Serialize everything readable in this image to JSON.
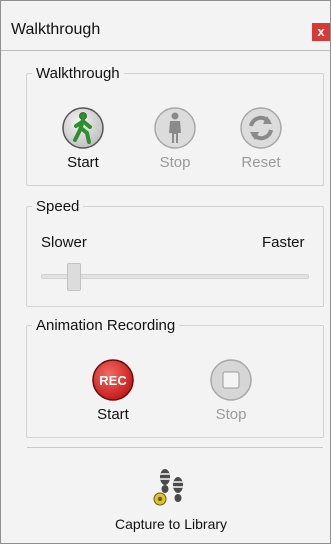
{
  "window": {
    "title": "Walkthrough",
    "close_glyph": "x"
  },
  "walkthrough_group": {
    "label": "Walkthrough",
    "buttons": [
      {
        "label": "Start",
        "icon": "walk-person-icon",
        "enabled": true,
        "accent": "#2d8f2d"
      },
      {
        "label": "Stop",
        "icon": "stand-person-icon",
        "enabled": false
      },
      {
        "label": "Reset",
        "icon": "reset-arrows-icon",
        "enabled": false
      }
    ]
  },
  "speed_group": {
    "label": "Speed",
    "min_label": "Slower",
    "max_label": "Faster",
    "value_fraction": 0.12
  },
  "recording_group": {
    "label": "Animation Recording",
    "rec_badge": "REC",
    "buttons": [
      {
        "label": "Start",
        "icon": "record-icon",
        "enabled": true,
        "accent": "#d32222"
      },
      {
        "label": "Stop",
        "icon": "stop-square-icon",
        "enabled": false
      }
    ]
  },
  "capture": {
    "label": "Capture to Library",
    "icon": "footprints-icon"
  }
}
